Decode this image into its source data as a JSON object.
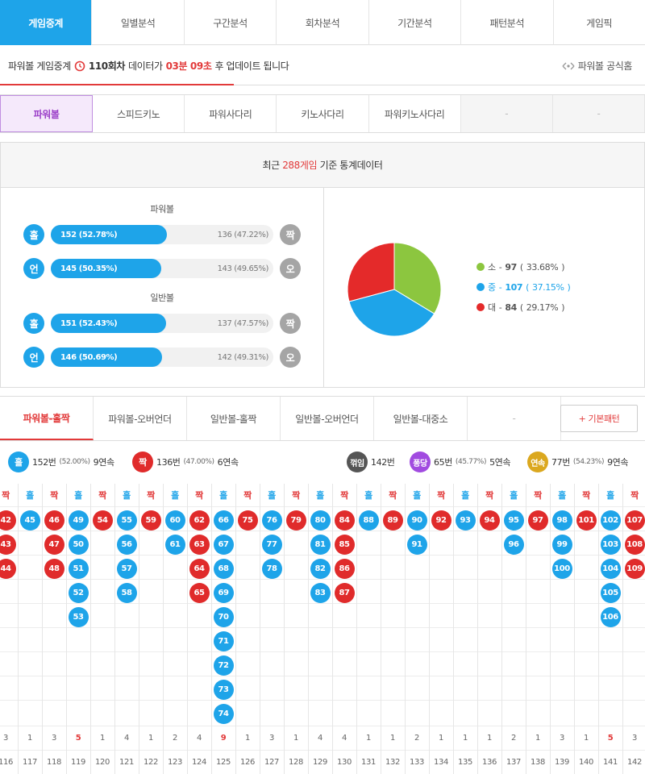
{
  "top_tabs": [
    "게임중계",
    "일별분석",
    "구간분석",
    "회차분석",
    "기간분석",
    "패턴분석",
    "게임픽"
  ],
  "info": {
    "game": "파워볼 게임중계",
    "round": "110회차",
    "data_label": "데이터가",
    "time": "03분 09초",
    "suffix": "후 업데이트 됩니다",
    "official": "파워볼 공식홈"
  },
  "sub_tabs": [
    "파워볼",
    "스피드키노",
    "파워사다리",
    "키노사다리",
    "파워키노사다리",
    "-",
    "-"
  ],
  "stats": {
    "title_pre": "최근",
    "title_games": "288게임",
    "title_post": "기준 통계데이터",
    "powerball_title": "파워볼",
    "normal_title": "일반볼",
    "rows": [
      {
        "left_icon": "홀",
        "left_text": "152 (52.78%)",
        "left_fraction": 0.5278,
        "right_text": "136 (47.22%)",
        "right_icon": "짝"
      },
      {
        "left_icon": "언",
        "left_text": "145 (50.35%)",
        "left_fraction": 0.5035,
        "right_text": "143 (49.65%)",
        "right_icon": "오"
      },
      {
        "left_icon": "홀",
        "left_text": "151 (52.43%)",
        "left_fraction": 0.5243,
        "right_text": "137 (47.57%)",
        "right_icon": "짝"
      },
      {
        "left_icon": "언",
        "left_text": "146 (50.69%)",
        "left_fraction": 0.5069,
        "right_text": "142 (49.31%)",
        "right_icon": "오"
      }
    ]
  },
  "chart_data": {
    "type": "pie",
    "categories": [
      "소",
      "중",
      "대"
    ],
    "values": [
      97,
      107,
      84
    ],
    "percents": [
      "33.68%",
      "37.15%",
      "29.17%"
    ],
    "colors": [
      "#8cc63f",
      "#1ea4e9",
      "#e42a2a"
    ],
    "legend": "right"
  },
  "pattern_tabs": [
    "파워볼-홀짝",
    "파워볼-오버언더",
    "일반볼-홀짝",
    "일반볼-오버언더",
    "일반볼-대중소",
    "-"
  ],
  "pattern_button": "+ 기본패턴",
  "summary": {
    "odd": {
      "icon": "홀",
      "count": "152번",
      "pct": "(52.00%)",
      "streak": "9연속"
    },
    "even": {
      "icon": "짝",
      "count": "136번",
      "pct": "(47.00%)",
      "streak": "6연속"
    },
    "switch": {
      "icon": "꺾임",
      "count": "142번"
    },
    "pong": {
      "icon": "퐁당",
      "count": "65번",
      "pct": "(45.77%)",
      "streak": "5연속"
    },
    "cont": {
      "icon": "연속",
      "count": "77번",
      "pct": "(54.23%)",
      "streak": "9연속"
    }
  },
  "grid": {
    "headers": [
      "짝",
      "홀",
      "짝",
      "홀",
      "짝",
      "홀",
      "짝",
      "홀",
      "짝",
      "홀",
      "짝",
      "홀",
      "짝",
      "홀",
      "짝",
      "홀",
      "짝",
      "홀",
      "짝",
      "홀",
      "짝",
      "홀",
      "짝",
      "홀",
      "짝",
      "홀",
      "짝"
    ],
    "columns": [
      [
        "42",
        "43",
        "44"
      ],
      [
        "45"
      ],
      [
        "46",
        "47",
        "48"
      ],
      [
        "49",
        "50",
        "51",
        "52",
        "53"
      ],
      [
        "54"
      ],
      [
        "55",
        "56",
        "57",
        "58"
      ],
      [
        "59"
      ],
      [
        "60",
        "61"
      ],
      [
        "62",
        "63",
        "64",
        "65"
      ],
      [
        "66",
        "67",
        "68",
        "69",
        "70",
        "71",
        "72",
        "73",
        "74"
      ],
      [
        "75"
      ],
      [
        "76",
        "77",
        "78"
      ],
      [
        "79"
      ],
      [
        "80",
        "81",
        "82",
        "83"
      ],
      [
        "84",
        "85",
        "86",
        "87"
      ],
      [
        "88"
      ],
      [
        "89"
      ],
      [
        "90",
        "91"
      ],
      [
        "92"
      ],
      [
        "93"
      ],
      [
        "94"
      ],
      [
        "95",
        "96"
      ],
      [
        "97"
      ],
      [
        "98",
        "99",
        "100"
      ],
      [
        "101"
      ],
      [
        "102",
        "103",
        "104",
        "105",
        "106"
      ],
      [
        "107",
        "108",
        "109"
      ]
    ],
    "counts": [
      "3",
      "1",
      "3",
      "5",
      "1",
      "4",
      "1",
      "2",
      "4",
      "9",
      "1",
      "3",
      "1",
      "4",
      "4",
      "1",
      "1",
      "2",
      "1",
      "1",
      "1",
      "2",
      "1",
      "3",
      "1",
      "5",
      "3"
    ],
    "rounds": [
      "116",
      "117",
      "118",
      "119",
      "120",
      "121",
      "122",
      "123",
      "124",
      "125",
      "126",
      "127",
      "128",
      "129",
      "130",
      "131",
      "132",
      "133",
      "134",
      "135",
      "136",
      "137",
      "138",
      "139",
      "140",
      "141",
      "142"
    ]
  }
}
